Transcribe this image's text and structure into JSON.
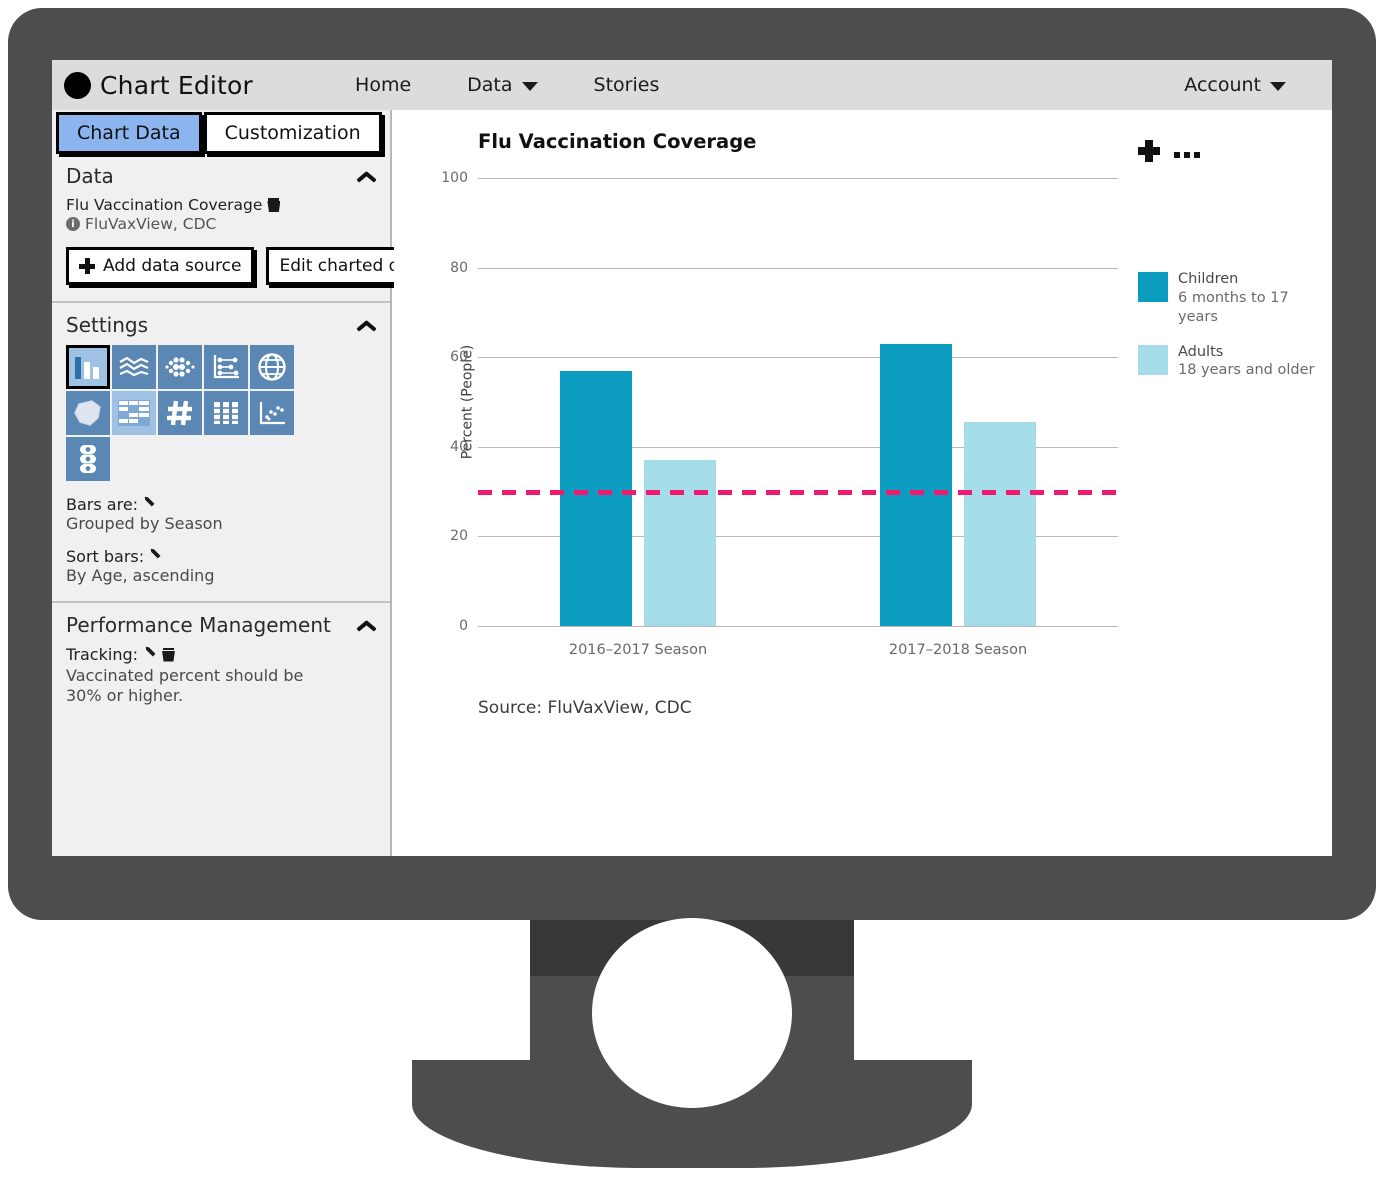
{
  "app": {
    "title": "Chart Editor",
    "logo_icon": "filled-circle-logo"
  },
  "nav": {
    "items": [
      {
        "label": "Home",
        "has_caret": false
      },
      {
        "label": "Data",
        "has_caret": true
      },
      {
        "label": "Stories",
        "has_caret": false
      }
    ],
    "account": {
      "label": "Account",
      "has_caret": true
    }
  },
  "sidebar": {
    "tabs": [
      {
        "label": "Chart Data",
        "active": true
      },
      {
        "label": "Customization",
        "active": false
      }
    ],
    "data_panel": {
      "title": "Data",
      "collapse_icon": "chevron-up-icon",
      "dataset_name": "Flu Vaccination Coverage",
      "delete_icon": "trash-icon",
      "info_icon": "info-icon",
      "dataset_source": "FluVaxView, CDC",
      "add_button": "Add data source",
      "add_icon": "plus-icon",
      "edit_button": "Edit charted data"
    },
    "settings_panel": {
      "title": "Settings",
      "collapse_icon": "chevron-up-icon",
      "chart_types": [
        {
          "name": "bar-chart-icon",
          "selected": true,
          "tone": "light"
        },
        {
          "name": "line-chart-icon",
          "selected": false,
          "tone": "dark"
        },
        {
          "name": "bubble-chart-icon",
          "selected": false,
          "tone": "dark"
        },
        {
          "name": "dot-plot-icon",
          "selected": false,
          "tone": "dark"
        },
        {
          "name": "globe-map-icon",
          "selected": false,
          "tone": "dark"
        },
        {
          "name": "polygon-map-icon",
          "selected": false,
          "tone": "dark"
        },
        {
          "name": "table-icon",
          "selected": false,
          "tone": "light"
        },
        {
          "name": "number-icon",
          "selected": false,
          "tone": "dark"
        },
        {
          "name": "bullet-chart-icon",
          "selected": false,
          "tone": "dark"
        },
        {
          "name": "scatter-plot-icon",
          "selected": false,
          "tone": "dark"
        },
        {
          "name": "traffic-light-icon",
          "selected": false,
          "tone": "dark"
        }
      ],
      "bars_label": "Bars are:",
      "bars_edit_icon": "pencil-icon",
      "bars_value": "Grouped by Season",
      "sort_label": "Sort bars:",
      "sort_edit_icon": "pencil-icon",
      "sort_value": "By Age, ascending"
    },
    "performance_panel": {
      "title": "Performance Management",
      "collapse_icon": "chevron-up-icon",
      "tracking_label": "Tracking:",
      "tracking_edit_icon": "pencil-icon",
      "tracking_delete_icon": "trash-icon",
      "tracking_value": "Vaccinated percent should be 30% or higher."
    }
  },
  "chart_panel": {
    "add_icon": "plus-icon",
    "more_icon": "ellipsis-icon",
    "source_note": "Source: FluVaxView, CDC"
  },
  "chart_data": {
    "type": "bar",
    "title": "Flu Vaccination Coverage",
    "xlabel": "",
    "ylabel": "Percent (People)",
    "ylim": [
      0,
      100
    ],
    "yticks": [
      0,
      20,
      40,
      60,
      80,
      100
    ],
    "grid": true,
    "legend_position": "right",
    "categories": [
      "2016–2017 Season",
      "2017–2018 Season"
    ],
    "series": [
      {
        "name": "Children",
        "sublabel": "6 months to 17 years",
        "color": "#0b9cc0",
        "values": [
          57,
          63
        ]
      },
      {
        "name": "Adults",
        "sublabel": "18 years and older",
        "color": "#a5dcea",
        "values": [
          37,
          45.5
        ]
      }
    ],
    "threshold": {
      "label": "Vaccinated percent should be 30% or higher.",
      "value": 30,
      "color": "#f01a6e",
      "style": "dashed"
    }
  },
  "colors": {
    "children": "#0b9cc0",
    "adults": "#a5dcea",
    "threshold": "#f01a6e",
    "tab_active": "#8cb4ef",
    "icon_dark": "#5b87b4",
    "icon_light": "#9fc2e4",
    "bezel": "#4d4d4d"
  }
}
